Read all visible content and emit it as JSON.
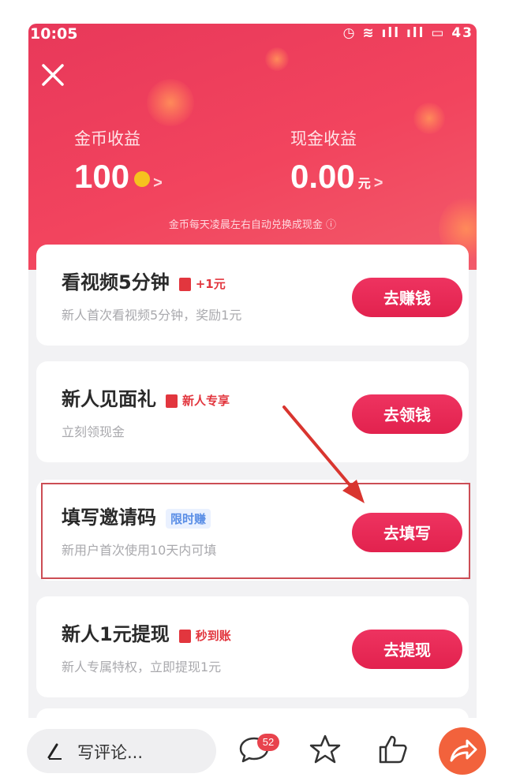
{
  "status_bar": {
    "time": "10:05",
    "right": "◷ ≋ ıll ıll ▭ 43"
  },
  "header": {
    "coins": {
      "label": "金币收益",
      "value": "100",
      "chevron": ">"
    },
    "cash": {
      "label": "现金收益",
      "value": "0.00",
      "unit": "元",
      "chevron": ">"
    },
    "note": "金币每天凌晨左右自动兑换成现金 ⓘ"
  },
  "tasks": [
    {
      "title": "看视频5分钟",
      "tag": "+1元",
      "subtitle": "新人首次看视频5分钟，奖励1元",
      "button": "去赚钱"
    },
    {
      "title": "新人见面礼",
      "tag": "新人专享",
      "subtitle": "立刻领现金",
      "button": "去领钱"
    },
    {
      "title": "填写邀请码",
      "tag": "限时赚",
      "subtitle": "新用户首次使用10天内可填",
      "button": "去填写"
    },
    {
      "title": "新人1元提现",
      "tag": "秒到账",
      "subtitle": "新人专属特权，立即提现1元",
      "button": "去提现"
    }
  ],
  "bottom_bar": {
    "comment_placeholder": "写评论...",
    "comment_count": "52"
  },
  "colors": {
    "header": "#ee3d5c",
    "button": "#e8284f",
    "arrow": "#d9352f",
    "share": "#f2623c"
  },
  "icons": [
    "close-icon",
    "coin-icon",
    "gift-icon",
    "pen-icon",
    "comment-icon",
    "star-icon",
    "thumbs-up-icon",
    "share-icon"
  ]
}
